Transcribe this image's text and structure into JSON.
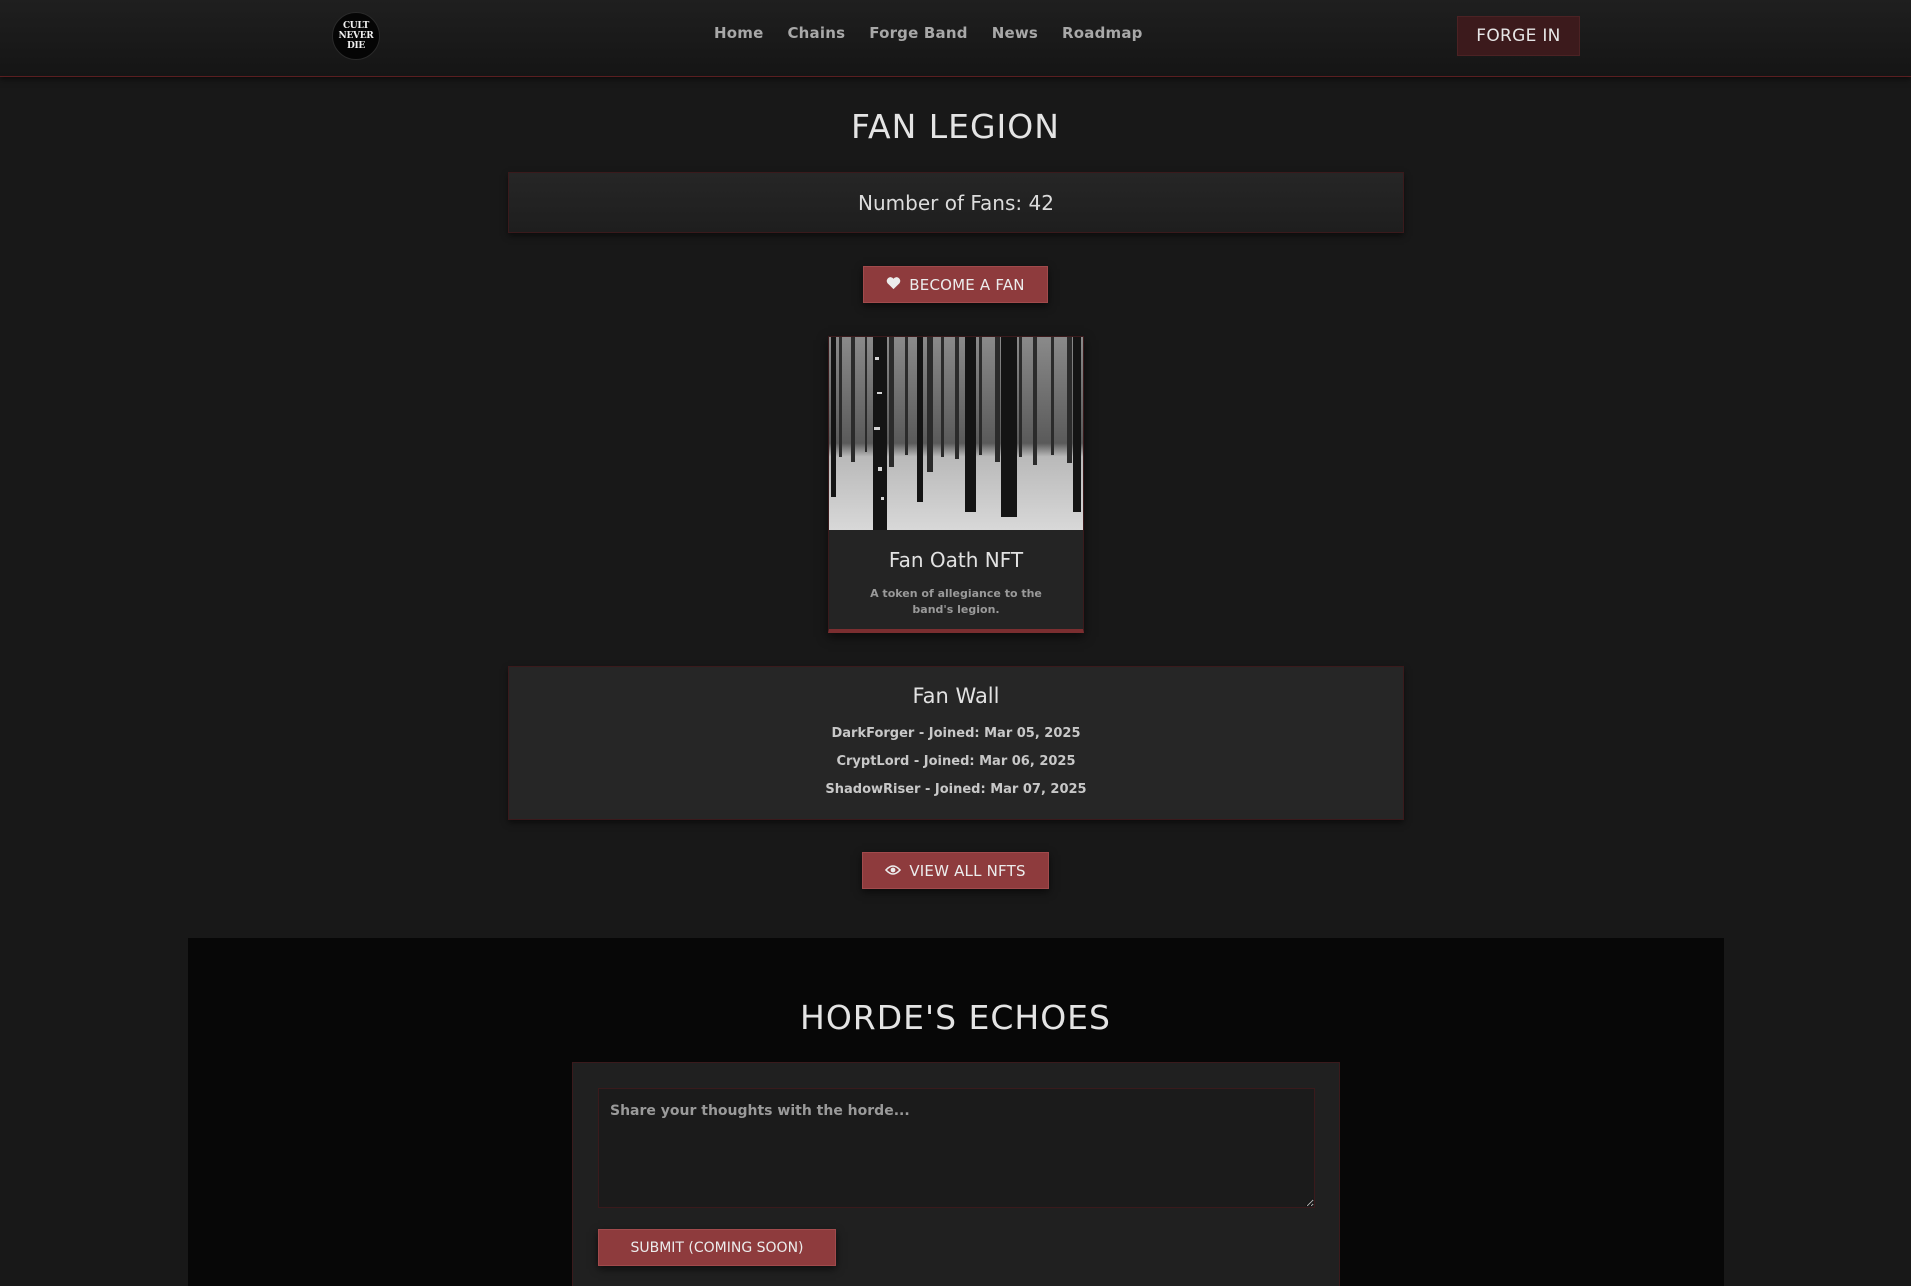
{
  "header": {
    "logo_lines": [
      "CULT",
      "NEVER",
      "DIE"
    ],
    "nav": [
      "Home",
      "Chains",
      "Forge Band",
      "News",
      "Roadmap"
    ],
    "forge_in_label": "FORGE IN"
  },
  "fan_legion": {
    "title": "FAN LEGION",
    "fan_count_text": "Number of Fans: 42",
    "become_fan_label": "BECOME A FAN",
    "become_fan_icon": "heart-icon",
    "nft": {
      "image": "snowy-birch-forest",
      "title": "Fan Oath NFT",
      "description": "A token of allegiance to the band's legion."
    },
    "fan_wall": {
      "title": "Fan Wall",
      "entries": [
        "DarkForger - Joined: Mar 05, 2025",
        "CryptLord - Joined: Mar 06, 2025",
        "ShadowRiser - Joined: Mar 07, 2025"
      ]
    },
    "view_all_label": "VIEW ALL NFTS",
    "view_all_icon": "eye-icon"
  },
  "echoes": {
    "title": "HORDE'S ECHOES",
    "textarea_placeholder": "Share your thoughts with the horde...",
    "submit_label": "SUBMIT (COMING SOON)"
  },
  "colors": {
    "accent": "#8e3b3d",
    "background": "#181818",
    "border": "#3a1a1c"
  }
}
